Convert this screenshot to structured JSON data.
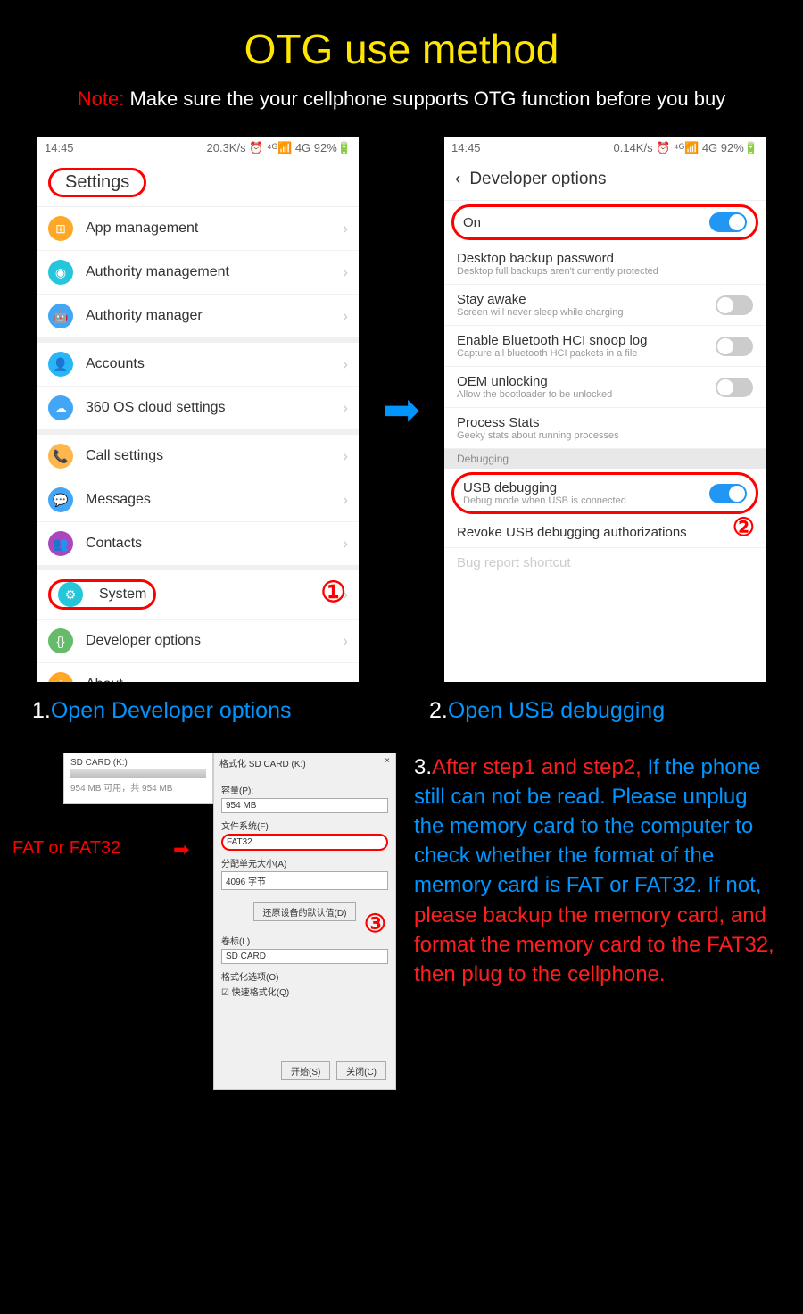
{
  "title": "OTG use method",
  "note": {
    "label": "Note:",
    "text": " Make sure the your cellphone supports OTG function before you buy"
  },
  "phone1": {
    "status": {
      "time": "14:45",
      "right": "20.3K/s ⏰ ⁴ᴳ📶 4G 92%🔋"
    },
    "header": "Settings",
    "groups": [
      [
        {
          "icon": "#ffa726",
          "glyph": "⊞",
          "label": "App management"
        },
        {
          "icon": "#26c6da",
          "glyph": "◉",
          "label": "Authority management"
        },
        {
          "icon": "#42a5f5",
          "glyph": "🤖",
          "label": "Authority manager"
        }
      ],
      [
        {
          "icon": "#29b6f6",
          "glyph": "👤",
          "label": "Accounts"
        },
        {
          "icon": "#42a5f5",
          "glyph": "☁",
          "label": "360 OS cloud settings"
        }
      ],
      [
        {
          "icon": "#ffb74d",
          "glyph": "📞",
          "label": "Call settings"
        },
        {
          "icon": "#42a5f5",
          "glyph": "💬",
          "label": "Messages"
        },
        {
          "icon": "#ab47bc",
          "glyph": "👥",
          "label": "Contacts"
        }
      ],
      [
        {
          "icon": "#26c6da",
          "glyph": "⚙",
          "label": "System",
          "circled": true
        },
        {
          "icon": "#66bb6a",
          "glyph": "{}",
          "label": "Developer options"
        },
        {
          "icon": "#ffa726",
          "glyph": "i",
          "label": "About"
        }
      ]
    ],
    "stepBadge": "①"
  },
  "phone2": {
    "status": {
      "time": "14:45",
      "right": "0.14K/s ⏰ ⁴ᴳ📶 4G 92%🔋"
    },
    "header": "Developer options",
    "items": [
      {
        "title": "On",
        "on": true,
        "circled": true
      },
      {
        "title": "Desktop backup password",
        "sub": "Desktop full backups aren't currently protected"
      },
      {
        "title": "Stay awake",
        "sub": "Screen will never sleep while charging",
        "toggle": false
      },
      {
        "title": "Enable Bluetooth HCI snoop log",
        "sub": "Capture all bluetooth HCI packets in a file",
        "toggle": false
      },
      {
        "title": "OEM unlocking",
        "sub": "Allow the bootloader to be unlocked",
        "toggle": false
      },
      {
        "title": "Process Stats",
        "sub": "Geeky stats about running processes"
      },
      {
        "section": "Debugging"
      },
      {
        "title": "USB debugging",
        "sub": "Debug mode when USB is connected",
        "on": true,
        "circled": true
      },
      {
        "title": "Revoke USB debugging authorizations"
      },
      {
        "title": "Bug report shortcut",
        "faded": true
      }
    ],
    "stepBadge": "②"
  },
  "captions": {
    "c1n": "1.",
    "c1t": "Open Developer options",
    "c2n": "2.",
    "c2t": "Open USB debugging"
  },
  "dialog": {
    "driveTitle": "SD CARD (K:)",
    "driveSub": "954 MB 可用，共 954 MB",
    "title": "格式化 SD CARD (K:)",
    "capLbl": "容量(P):",
    "cap": "954 MB",
    "fsLbl": "文件系统(F)",
    "fs": "FAT32",
    "auLbl": "分配单元大小(A)",
    "au": "4096 字节",
    "restore": "还原设备的默认值(D)",
    "volLbl": "卷标(L)",
    "vol": "SD CARD",
    "optLbl": "格式化选项(O)",
    "quick": "快速格式化(Q)",
    "start": "开始(S)",
    "close": "关闭(C)",
    "fatLabel": "FAT or FAT32",
    "stepBadge": "③"
  },
  "step3": {
    "num": "3.",
    "red1": "After step1 and step2,",
    "blue1": "If the phone still can not be read. Please unplug the memory card to the computer to check whether the format of the memory card is FAT or FAT32. If not, ",
    "red2": "please backup the memory card, and format the memory card to the FAT32, then plug to the cellphone."
  }
}
